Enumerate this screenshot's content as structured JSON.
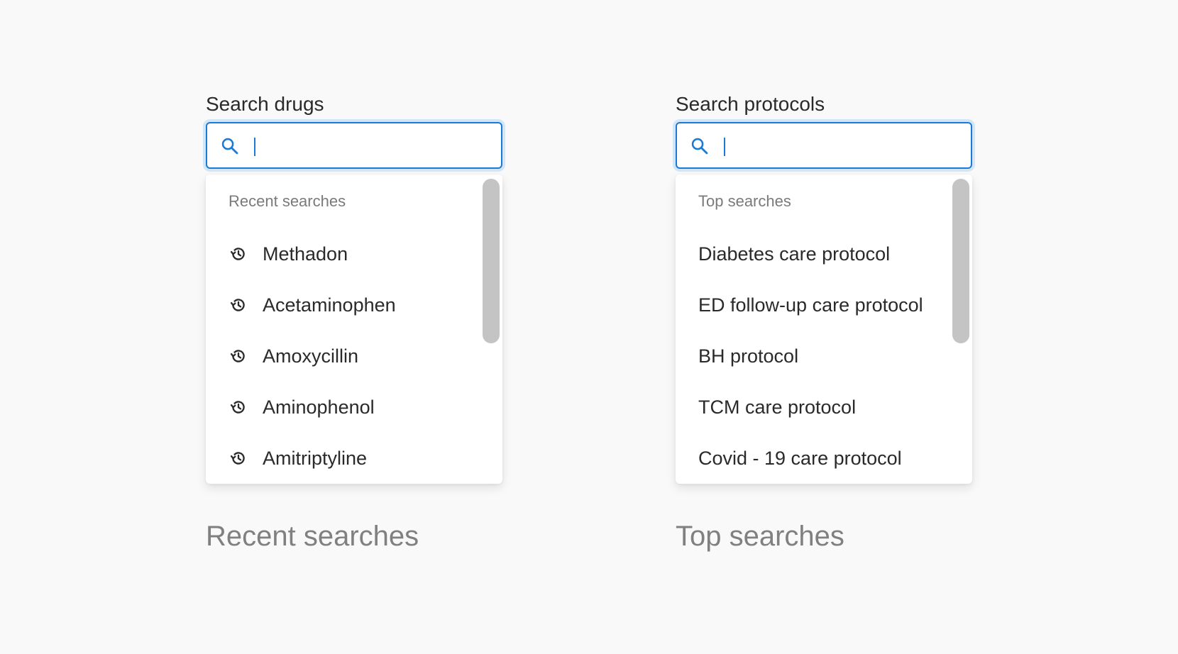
{
  "colors": {
    "accent": "#1b7ad6",
    "focus_ring": "#d3e6f8",
    "text": "#2a2a2a",
    "muted": "#7a7a7a",
    "caption": "#808080",
    "scrollbar": "#c4c4c4",
    "background": "#f9f9f9"
  },
  "drugs": {
    "label": "Search drugs",
    "input_value": "",
    "icon": "search-icon",
    "dropdown": {
      "heading": "Recent searches",
      "item_icon": "history-icon",
      "items": [
        {
          "label": "Methadon"
        },
        {
          "label": "Acetaminophen"
        },
        {
          "label": "Amoxycillin"
        },
        {
          "label": "Aminophenol"
        },
        {
          "label": "Amitriptyline"
        }
      ]
    },
    "caption": "Recent searches"
  },
  "protocols": {
    "label": "Search protocols",
    "input_value": "",
    "icon": "search-icon",
    "dropdown": {
      "heading": "Top searches",
      "items": [
        {
          "label": "Diabetes care protocol"
        },
        {
          "label": "ED follow-up care protocol"
        },
        {
          "label": "BH protocol"
        },
        {
          "label": "TCM care protocol"
        },
        {
          "label": "Covid - 19 care protocol"
        }
      ]
    },
    "caption": "Top searches"
  }
}
